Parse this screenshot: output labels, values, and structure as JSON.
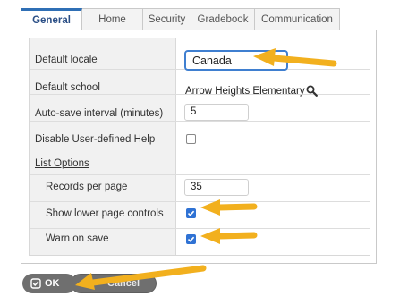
{
  "tabs": [
    {
      "label": "General",
      "active": true
    },
    {
      "label": "Home",
      "active": false
    },
    {
      "label": "Security",
      "active": false
    },
    {
      "label": "Gradebook",
      "active": false
    },
    {
      "label": "Communication",
      "active": false
    }
  ],
  "settings": {
    "default_locale": {
      "label": "Default locale",
      "value": "Canada"
    },
    "default_school": {
      "label": "Default school",
      "value": "Arrow Heights Elementary",
      "icon": "search-icon"
    },
    "auto_save": {
      "label": "Auto-save interval (minutes)",
      "value": "5"
    },
    "disable_help": {
      "label": "Disable User-defined Help",
      "checked": false
    }
  },
  "list_options": {
    "heading": "List Options",
    "records_per_page": {
      "label": "Records per page",
      "value": "35"
    },
    "show_lower_page_controls": {
      "label": "Show lower page controls",
      "checked": true
    },
    "warn_on_save": {
      "label": "Warn on save",
      "checked": true
    }
  },
  "buttons": {
    "ok": "OK",
    "cancel": "Cancel"
  },
  "colors": {
    "accent": "#2f72d4",
    "annotation_arrow": "#f2b01e"
  }
}
